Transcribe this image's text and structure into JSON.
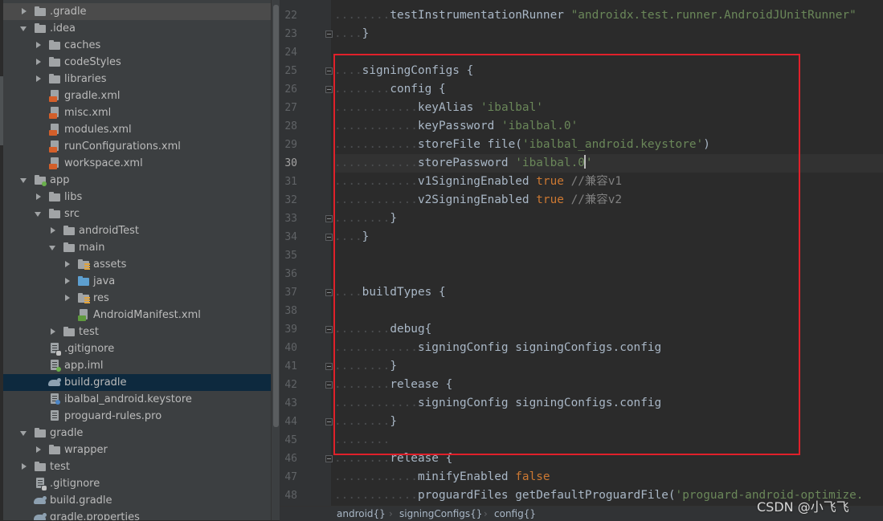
{
  "tree": {
    "rows": [
      {
        "label": ".gradle",
        "depth": 1,
        "expanded": false,
        "icon": "folder-icon"
      },
      {
        "label": ".idea",
        "depth": 1,
        "expanded": true,
        "icon": "folder-icon"
      },
      {
        "label": "caches",
        "depth": 2,
        "expanded": false,
        "icon": "folder-icon"
      },
      {
        "label": "codeStyles",
        "depth": 2,
        "expanded": false,
        "icon": "folder-icon"
      },
      {
        "label": "libraries",
        "depth": 2,
        "expanded": false,
        "icon": "folder-icon"
      },
      {
        "label": "gradle.xml",
        "depth": 2,
        "icon": "xml-file-icon"
      },
      {
        "label": "misc.xml",
        "depth": 2,
        "icon": "xml-file-icon"
      },
      {
        "label": "modules.xml",
        "depth": 2,
        "icon": "xml-file-icon"
      },
      {
        "label": "runConfigurations.xml",
        "depth": 2,
        "icon": "xml-file-icon"
      },
      {
        "label": "workspace.xml",
        "depth": 2,
        "icon": "xml-file-icon"
      },
      {
        "label": "app",
        "depth": 1,
        "expanded": true,
        "icon": "module-folder-icon"
      },
      {
        "label": "libs",
        "depth": 2,
        "expanded": false,
        "icon": "folder-icon"
      },
      {
        "label": "src",
        "depth": 2,
        "expanded": true,
        "icon": "folder-icon"
      },
      {
        "label": "androidTest",
        "depth": 3,
        "expanded": false,
        "icon": "folder-icon"
      },
      {
        "label": "main",
        "depth": 3,
        "expanded": true,
        "icon": "folder-icon"
      },
      {
        "label": "assets",
        "depth": 4,
        "expanded": false,
        "icon": "assets-folder-icon"
      },
      {
        "label": "java",
        "depth": 4,
        "expanded": false,
        "icon": "source-folder-icon"
      },
      {
        "label": "res",
        "depth": 4,
        "expanded": false,
        "icon": "resources-folder-icon"
      },
      {
        "label": "AndroidManifest.xml",
        "depth": 4,
        "icon": "manifest-file-icon"
      },
      {
        "label": "test",
        "depth": 3,
        "expanded": false,
        "icon": "folder-icon"
      },
      {
        "label": ".gitignore",
        "depth": 2,
        "icon": "gitignore-file-icon"
      },
      {
        "label": "app.iml",
        "depth": 2,
        "icon": "iml-file-icon"
      },
      {
        "label": "build.gradle",
        "depth": 2,
        "icon": "gradle-file-icon",
        "selected": true
      },
      {
        "label": "ibalbal_android.keystore",
        "depth": 2,
        "icon": "keystore-file-icon"
      },
      {
        "label": "proguard-rules.pro",
        "depth": 2,
        "icon": "text-file-icon"
      },
      {
        "label": "gradle",
        "depth": 1,
        "expanded": true,
        "icon": "folder-icon"
      },
      {
        "label": "wrapper",
        "depth": 2,
        "expanded": false,
        "icon": "folder-icon"
      },
      {
        "label": "test",
        "depth": 1,
        "expanded": false,
        "icon": "folder-icon"
      },
      {
        "label": ".gitignore",
        "depth": 1,
        "icon": "gitignore-file-icon"
      },
      {
        "label": "build.gradle",
        "depth": 1,
        "icon": "gradle-file-icon"
      },
      {
        "label": "gradle.properties",
        "depth": 1,
        "icon": "gradle-file-icon"
      }
    ]
  },
  "editor": {
    "current_line": 30,
    "lines": [
      {
        "num": 22,
        "indent": 2,
        "tokens": [
          {
            "t": "testInstrumentationRunner ",
            "c": "id"
          },
          {
            "t": "\"androidx.test.runner.AndroidJUnitRunner\"",
            "c": "str"
          }
        ]
      },
      {
        "num": 23,
        "indent": 1,
        "fold": true,
        "tokens": [
          {
            "t": "}",
            "c": "id"
          }
        ]
      },
      {
        "num": 24,
        "indent": 0,
        "tokens": []
      },
      {
        "num": 25,
        "indent": 1,
        "fold": true,
        "tokens": [
          {
            "t": "signingConfigs {",
            "c": "id"
          }
        ]
      },
      {
        "num": 26,
        "indent": 2,
        "fold": true,
        "tokens": [
          {
            "t": "config {",
            "c": "id"
          }
        ]
      },
      {
        "num": 27,
        "indent": 3,
        "tokens": [
          {
            "t": "keyAlias ",
            "c": "id"
          },
          {
            "t": "'ibalbal'",
            "c": "str"
          }
        ]
      },
      {
        "num": 28,
        "indent": 3,
        "tokens": [
          {
            "t": "keyPassword ",
            "c": "id"
          },
          {
            "t": "'ibalbal.0'",
            "c": "str"
          }
        ]
      },
      {
        "num": 29,
        "indent": 3,
        "tokens": [
          {
            "t": "storeFile file(",
            "c": "id"
          },
          {
            "t": "'ibalbal_android.keystore'",
            "c": "str"
          },
          {
            "t": ")",
            "c": "id"
          }
        ]
      },
      {
        "num": 30,
        "indent": 3,
        "tokens": [
          {
            "t": "storePassword ",
            "c": "id"
          },
          {
            "t": "'ibalbal.0",
            "c": "str"
          },
          {
            "t": "",
            "c": "caret"
          },
          {
            "t": "'",
            "c": "str"
          }
        ]
      },
      {
        "num": 31,
        "indent": 3,
        "tokens": [
          {
            "t": "v1SigningEnabled ",
            "c": "id"
          },
          {
            "t": "true",
            "c": "kw"
          },
          {
            "t": " //兼容v1",
            "c": "cmt"
          }
        ]
      },
      {
        "num": 32,
        "indent": 3,
        "tokens": [
          {
            "t": "v2SigningEnabled ",
            "c": "id"
          },
          {
            "t": "true",
            "c": "kw"
          },
          {
            "t": " //兼容v2",
            "c": "cmt"
          }
        ]
      },
      {
        "num": 33,
        "indent": 2,
        "fold": true,
        "tokens": [
          {
            "t": "}",
            "c": "id"
          }
        ]
      },
      {
        "num": 34,
        "indent": 1,
        "fold": true,
        "tokens": [
          {
            "t": "}",
            "c": "id"
          }
        ]
      },
      {
        "num": 35,
        "indent": 0,
        "tokens": []
      },
      {
        "num": 36,
        "indent": 0,
        "tokens": []
      },
      {
        "num": 37,
        "indent": 1,
        "fold": true,
        "tokens": [
          {
            "t": "buildTypes {",
            "c": "id"
          }
        ]
      },
      {
        "num": 38,
        "indent": 0,
        "tokens": []
      },
      {
        "num": 39,
        "indent": 2,
        "fold": true,
        "tokens": [
          {
            "t": "debug{",
            "c": "id"
          }
        ]
      },
      {
        "num": 40,
        "indent": 3,
        "tokens": [
          {
            "t": "signingConfig signingConfigs.config",
            "c": "id"
          }
        ]
      },
      {
        "num": 41,
        "indent": 2,
        "fold": true,
        "tokens": [
          {
            "t": "}",
            "c": "id"
          }
        ]
      },
      {
        "num": 42,
        "indent": 2,
        "fold": true,
        "tokens": [
          {
            "t": "release {",
            "c": "id"
          }
        ]
      },
      {
        "num": 43,
        "indent": 3,
        "tokens": [
          {
            "t": "signingConfig signingConfigs.config",
            "c": "id"
          }
        ]
      },
      {
        "num": 44,
        "indent": 2,
        "fold": true,
        "tokens": [
          {
            "t": "}",
            "c": "id"
          }
        ]
      },
      {
        "num": 45,
        "indent": 2,
        "tokens": []
      },
      {
        "num": 46,
        "indent": 2,
        "fold": true,
        "tokens": [
          {
            "t": "release {",
            "c": "id"
          }
        ]
      },
      {
        "num": 47,
        "indent": 3,
        "tokens": [
          {
            "t": "minifyEnabled ",
            "c": "id"
          },
          {
            "t": "false",
            "c": "kw"
          }
        ]
      },
      {
        "num": 48,
        "indent": 3,
        "tokens": [
          {
            "t": "proguardFiles getDefaultProguardFile(",
            "c": "id"
          },
          {
            "t": "'proguard-android-optimize.",
            "c": "str"
          }
        ]
      }
    ]
  },
  "breadcrumb": {
    "items": [
      "android{}",
      "signingConfigs{}",
      "config{}"
    ]
  },
  "watermark": "CSDN @小飞飞",
  "colors": {
    "string": "#6a8759",
    "keyword": "#cc7832",
    "comment": "#808080",
    "identifier": "#a9b7c6",
    "highlight_box": "#e0202a"
  }
}
